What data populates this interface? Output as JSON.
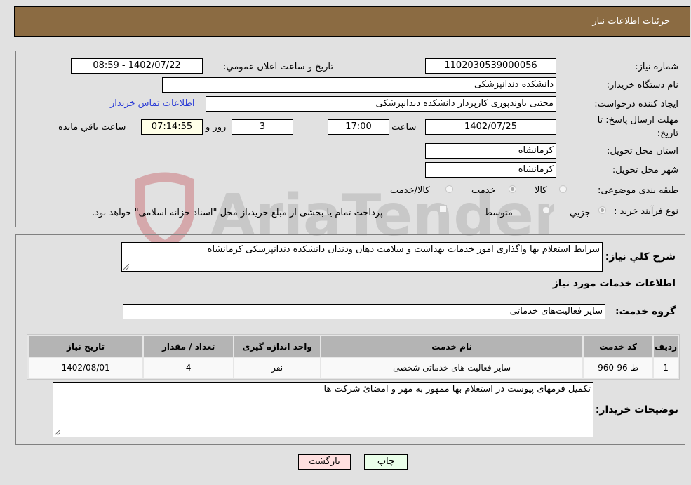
{
  "header": {
    "title": "جزئیات اطلاعات نیاز"
  },
  "form": {
    "need_number": {
      "label": "شماره نیاز:",
      "value": "1102030539000056"
    },
    "announce_datetime": {
      "label": "تاریخ و ساعت اعلان عمومي:",
      "value": "1402/07/22 - 08:59"
    },
    "buyer_org": {
      "label": "نام دستگاه خریدار:",
      "value": "دانشکده دندانپزشکی"
    },
    "requester": {
      "label": "ایجاد کننده درخواست:",
      "value": "مجتبی  باوندپوری کارپرداز دانشکده دندانپزشکی",
      "contact_link": "اطلاعات تماس خریدار"
    },
    "deadline": {
      "label_line1": "مهلت ارسال پاسخ: تا",
      "label_line2": "تاریخ:",
      "date": "1402/07/25",
      "time_label": "ساعت",
      "time": "17:00",
      "days": "3",
      "days_label": "روز و",
      "remaining": "07:14:55",
      "remaining_label": "ساعت باقي مانده"
    },
    "province": {
      "label": "استان محل تحویل:",
      "value": "کرمانشاه"
    },
    "city": {
      "label": "شهر محل تحویل:",
      "value": "کرمانشاه"
    },
    "category": {
      "label": "طبقه بندی موضوعی:",
      "options": [
        "کالا",
        "خدمت",
        "کالا/خدمت"
      ],
      "selected": "خدمت"
    },
    "purchase_type": {
      "label": "نوع فرآیند خرید :",
      "options": [
        "جزيي",
        "متوسط"
      ],
      "selected": "جزيي",
      "treasury_note": "پرداخت تمام یا بخشی از مبلغ خرید،از محل \"اسناد خزانه اسلامی\" خواهد بود."
    }
  },
  "details": {
    "description_label": "شرح کلي نیاز:",
    "description": "شرایط استعلام بها واگذاری امور خدمات بهداشت و سلامت دهان ودندان دانشکده دندانپزشکی کرمانشاه",
    "services_title": "اطلاعات خدمات مورد نیاز",
    "service_group_label": "گروه خدمت:",
    "service_group": "سایر فعالیت‌های خدماتی",
    "table": {
      "headers": [
        "ردیف",
        "کد خدمت",
        "نام خدمت",
        "واحد اندازه گیری",
        "تعداد / مقدار",
        "تاریخ نیاز"
      ],
      "rows": [
        [
          "1",
          "ط-96-960",
          "سایر فعالیت های خدماتی شخصی",
          "نفر",
          "4",
          "1402/08/01"
        ]
      ]
    },
    "buyer_notes_label": "توضیحات خریدار:",
    "buyer_notes": "تکمیل فرمهای پیوست در استعلام بها ممهور به مهر و امضائ شرکت ها"
  },
  "buttons": {
    "print": "چاپ",
    "back": "بازگشت"
  },
  "watermark": {
    "text": "AriaTender.neT"
  },
  "colors": {
    "header_bg": "#8b6b42",
    "print_bg": "#eaffea",
    "back_bg": "#ffe0e0",
    "link": "#2a3bd6"
  }
}
